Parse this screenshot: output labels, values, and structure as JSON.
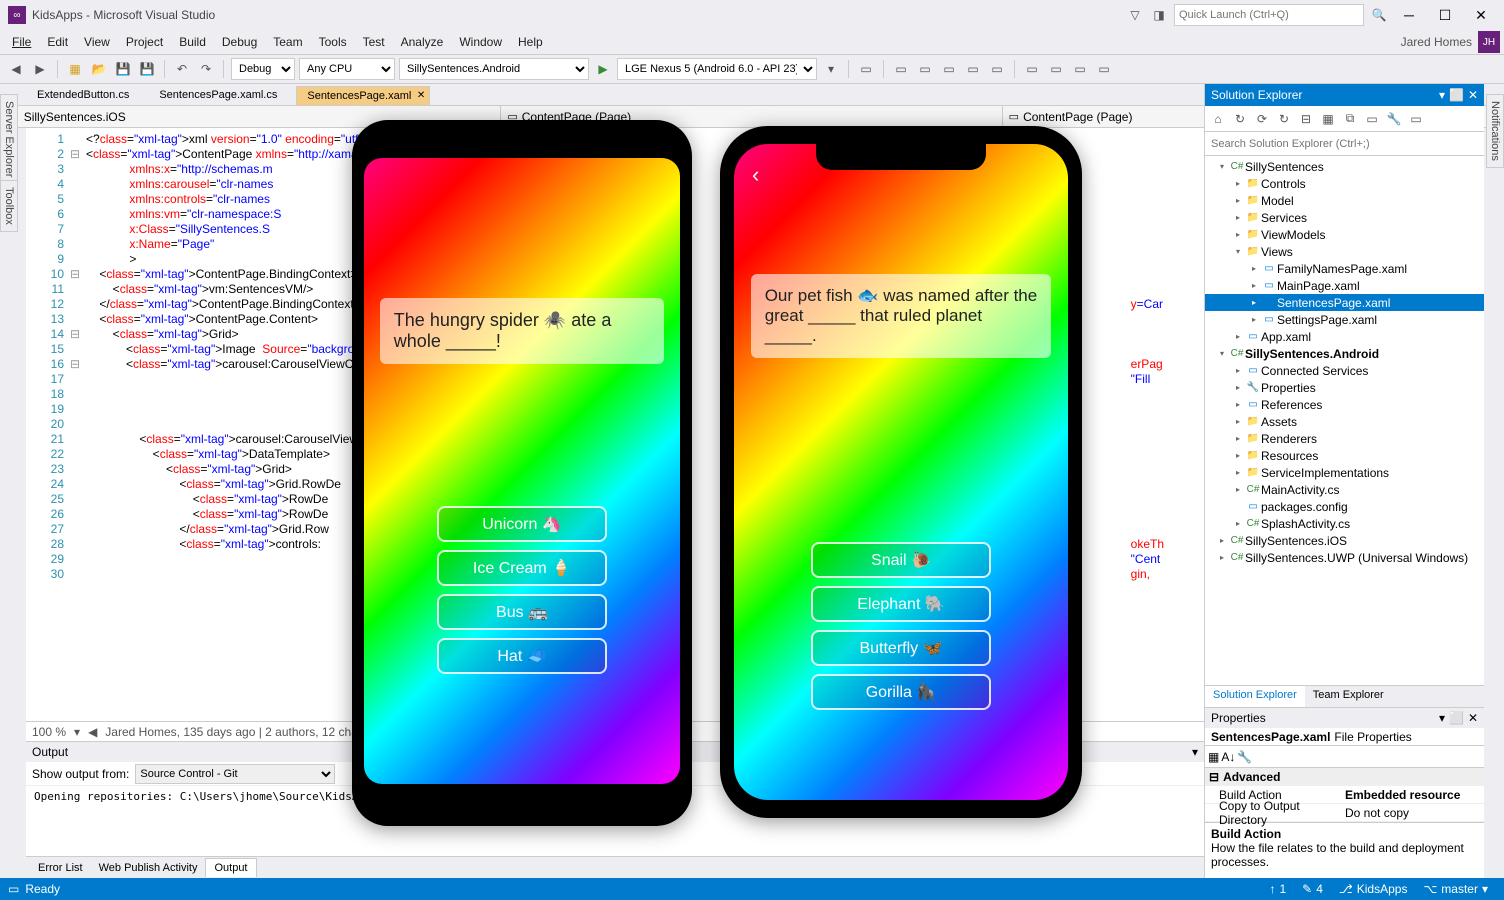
{
  "titlebar": {
    "app_icon": "∞",
    "title": "KidsApps - Microsoft Visual Studio",
    "quick_launch_placeholder": "Quick Launch (Ctrl+Q)"
  },
  "menubar": {
    "items": [
      "File",
      "Edit",
      "View",
      "Project",
      "Build",
      "Debug",
      "Team",
      "Tools",
      "Test",
      "Analyze",
      "Window",
      "Help"
    ],
    "user": "Jared Homes",
    "avatar": "JH"
  },
  "toolbar": {
    "config": "Debug",
    "platform": "Any CPU",
    "startup": "SillySentences.Android",
    "device": "LGE Nexus 5 (Android 6.0 - API 23)"
  },
  "side_tabs": {
    "left1": "Server Explorer",
    "left2": "Toolbox",
    "right": "Notifications"
  },
  "tabs": [
    {
      "label": "ExtendedButton.cs",
      "active": false
    },
    {
      "label": "SentencesPage.xaml.cs",
      "active": false
    },
    {
      "label": "SentencesPage.xaml",
      "active": true
    }
  ],
  "navbar": {
    "left": "SillySentences.iOS",
    "mid": "ContentPage (Page)",
    "right": "ContentPage (Page)"
  },
  "code": [
    {
      "n": 1,
      "t": "<?xml version=\"1.0\" encoding=\"utf-8\" ?>"
    },
    {
      "n": 2,
      "t": "<ContentPage xmlns=\"http://xamarin.com/"
    },
    {
      "n": 3,
      "t": "             xmlns:x=\"http://schemas.m"
    },
    {
      "n": 4,
      "t": "             xmlns:carousel=\"clr-names"
    },
    {
      "n": 5,
      "t": "             xmlns:controls=\"clr-names"
    },
    {
      "n": 6,
      "t": "             xmlns:vm=\"clr-namespace:S"
    },
    {
      "n": 7,
      "t": "             x:Class=\"SillySentences.S"
    },
    {
      "n": 8,
      "t": "             x:Name=\"Page\""
    },
    {
      "n": 9,
      "t": "             >"
    },
    {
      "n": 10,
      "t": "    <ContentPage.BindingContext>"
    },
    {
      "n": 11,
      "t": "        <vm:SentencesVM/>"
    },
    {
      "n": 12,
      "t": "    </ContentPage.BindingContext>"
    },
    {
      "n": 13,
      "t": "    <ContentPage.Content>"
    },
    {
      "n": 14,
      "t": "        <Grid>"
    },
    {
      "n": 15,
      "t": "            <Image  Source=\"background"
    },
    {
      "n": 16,
      "t": "            <carousel:CarouselViewCont"
    },
    {
      "n": 17,
      "t": ""
    },
    {
      "n": 18,
      "t": ""
    },
    {
      "n": 19,
      "t": ""
    },
    {
      "n": 20,
      "t": ""
    },
    {
      "n": 21,
      "t": "                <carousel:CarouselView"
    },
    {
      "n": 22,
      "t": "                    <DataTemplate>"
    },
    {
      "n": 23,
      "t": "                        <Grid>"
    },
    {
      "n": 24,
      "t": "                            <Grid.RowDe"
    },
    {
      "n": 25,
      "t": "                                <RowDe"
    },
    {
      "n": 26,
      "t": "                                <RowDe"
    },
    {
      "n": 27,
      "t": "                            </Grid.Row"
    },
    {
      "n": 28,
      "t": "                            <controls:"
    },
    {
      "n": 29,
      "t": ""
    },
    {
      "n": 30,
      "t": ""
    }
  ],
  "code_right_fragments": [
    "y=Car",
    "erPag",
    "\"Fill",
    "okeTh",
    "\"Cent",
    "gin,"
  ],
  "zoom_bar": {
    "zoom": "100 %",
    "blame": "Jared Homes, 135 days ago | 2 authors, 12 changes"
  },
  "output": {
    "header": "Output",
    "show_from_label": "Show output from:",
    "show_from_value": "Source Control - Git",
    "body": "Opening repositories:\nC:\\Users\\jhome\\Source\\KidsApps",
    "tabs": [
      "Error List",
      "Web Publish Activity",
      "Output"
    ]
  },
  "solution_explorer": {
    "title": "Solution Explorer",
    "search_placeholder": "Search Solution Explorer (Ctrl+;)",
    "tree": [
      {
        "indent": 0,
        "exp": "▾",
        "icon": "cs",
        "label": "SillySentences"
      },
      {
        "indent": 1,
        "exp": "▸",
        "icon": "folder",
        "label": "Controls"
      },
      {
        "indent": 1,
        "exp": "▸",
        "icon": "folder",
        "label": "Model"
      },
      {
        "indent": 1,
        "exp": "▸",
        "icon": "folder",
        "label": "Services"
      },
      {
        "indent": 1,
        "exp": "▸",
        "icon": "folder",
        "label": "ViewModels"
      },
      {
        "indent": 1,
        "exp": "▾",
        "icon": "folder",
        "label": "Views"
      },
      {
        "indent": 2,
        "exp": "▸",
        "icon": "xaml",
        "label": "FamilyNamesPage.xaml"
      },
      {
        "indent": 2,
        "exp": "▸",
        "icon": "xaml",
        "label": "MainPage.xaml"
      },
      {
        "indent": 2,
        "exp": "▸",
        "icon": "xaml",
        "label": "SentencesPage.xaml",
        "selected": true
      },
      {
        "indent": 2,
        "exp": "▸",
        "icon": "xaml",
        "label": "SettingsPage.xaml"
      },
      {
        "indent": 1,
        "exp": "▸",
        "icon": "xaml",
        "label": "App.xaml"
      },
      {
        "indent": 0,
        "exp": "▾",
        "icon": "cs",
        "label": "SillySentences.Android",
        "bold": true
      },
      {
        "indent": 1,
        "exp": "▸",
        "icon": "ref",
        "label": "Connected Services"
      },
      {
        "indent": 1,
        "exp": "▸",
        "icon": "wrench",
        "label": "Properties"
      },
      {
        "indent": 1,
        "exp": "▸",
        "icon": "ref",
        "label": "References"
      },
      {
        "indent": 1,
        "exp": "▸",
        "icon": "folder",
        "label": "Assets"
      },
      {
        "indent": 1,
        "exp": "▸",
        "icon": "folder",
        "label": "Renderers"
      },
      {
        "indent": 1,
        "exp": "▸",
        "icon": "folder",
        "label": "Resources"
      },
      {
        "indent": 1,
        "exp": "▸",
        "icon": "folder",
        "label": "ServiceImplementations"
      },
      {
        "indent": 1,
        "exp": "▸",
        "icon": "cs",
        "label": "MainActivity.cs"
      },
      {
        "indent": 1,
        "exp": "",
        "icon": "file",
        "label": "packages.config"
      },
      {
        "indent": 1,
        "exp": "▸",
        "icon": "cs",
        "label": "SplashActivity.cs"
      },
      {
        "indent": 0,
        "exp": "▸",
        "icon": "cs",
        "label": "SillySentences.iOS"
      },
      {
        "indent": 0,
        "exp": "▸",
        "icon": "cs",
        "label": "SillySentences.UWP (Universal Windows)"
      }
    ],
    "tabs": [
      "Solution Explorer",
      "Team Explorer"
    ]
  },
  "properties": {
    "title": "Properties",
    "file": "SentencesPage.xaml",
    "file_suffix": "File Properties",
    "cat": "Advanced",
    "rows": [
      {
        "name": "Build Action",
        "value": "Embedded resource"
      },
      {
        "name": "Copy to Output Directory",
        "value": "Do not copy"
      }
    ],
    "desc_title": "Build Action",
    "desc_body": "How the file relates to the build and deployment processes."
  },
  "statusbar": {
    "ready": "Ready",
    "up": "1",
    "pencil": "4",
    "repo": "KidsApps",
    "branch": "master"
  },
  "phones": {
    "android": {
      "sentence": "The hungry spider 🕷️ ate a whole _____!",
      "buttons": [
        "Unicorn 🦄",
        "Ice Cream 🍦",
        "Bus 🚌",
        "Hat 🧢"
      ]
    },
    "ios": {
      "sentence": "Our pet fish 🐟 was named after the great _____ that ruled planet _____.",
      "buttons": [
        "Snail 🐌",
        "Elephant 🐘",
        "Butterfly 🦋",
        "Gorilla 🦍"
      ]
    }
  }
}
